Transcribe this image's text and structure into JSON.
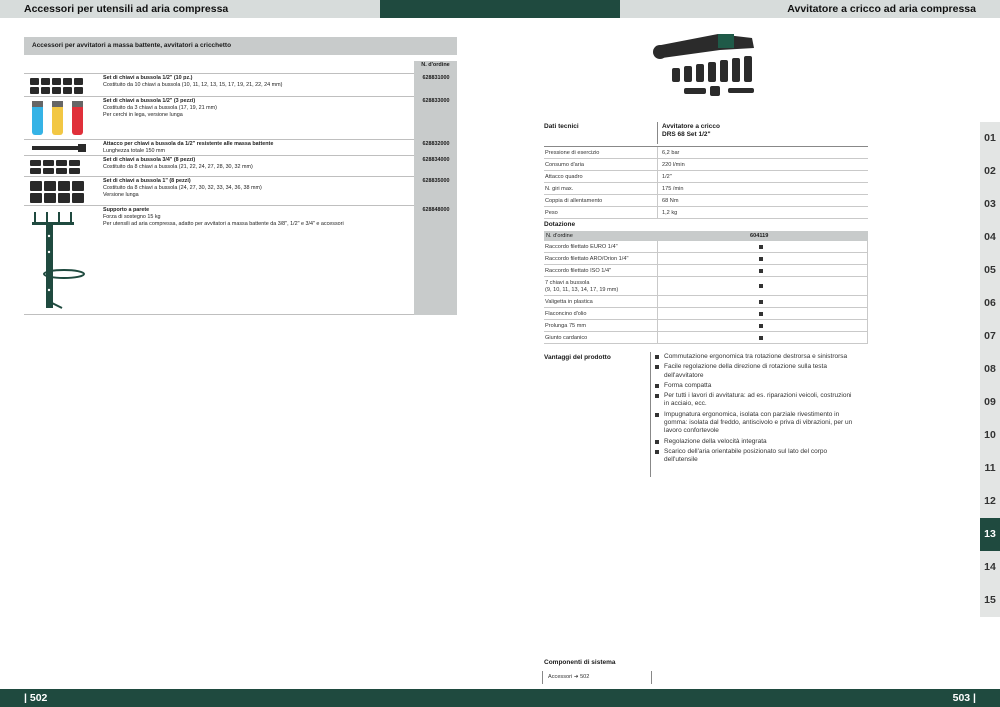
{
  "header": {
    "left_title": "Accessori per utensili ad aria compressa",
    "right_title": "Avvitatore a cricco ad aria compressa"
  },
  "footer": {
    "left_page": "| 502",
    "right_page": "503 |"
  },
  "accessories": {
    "section_title": "Accessori per avvitatori a massa battente, avvitatori a cricchetto",
    "order_header": "N. d'ordine",
    "items": [
      {
        "title": "Set di chiavi a bussola 1/2\" (10 pz.)",
        "lines": [
          "Costituito da 10 chiavi a bussola (10, 11, 12, 13, 15, 17, 19, 21, 22, 24 mm)"
        ],
        "order": "628831000"
      },
      {
        "title": "Set di chiavi a bussola 1/2\" (3 pezzi)",
        "lines": [
          "Costituito da 3 chiavi a bussola (17, 19, 21 mm)",
          "Per cerchi in lega, versione lunga"
        ],
        "order": "628833000"
      },
      {
        "title": "Attacco per chiavi a bussola da 1/2\" resistente alle massa battente",
        "lines": [
          "Lunghezza totale 150 mm"
        ],
        "order": "628832000"
      },
      {
        "title": "Set di chiavi a bussola 3/4\" (8 pezzi)",
        "lines": [
          "Costituito da 8 chiavi a bussola (21, 22, 24, 27, 28, 30, 32 mm)"
        ],
        "order": "628834000"
      },
      {
        "title": "Set di chiavi a bussola 1\" (8 pezzi)",
        "lines": [
          "Costituito da 8 chiavi a bussola (24, 27, 30, 32, 33, 34, 36, 38 mm)",
          "Versione lunga"
        ],
        "order": "628835000"
      },
      {
        "title": "Supporto a parete",
        "lines": [
          "Forza di sostegno 15 kg",
          "Per utensili ad aria compressa, adatto per avvitatori a massa battente da 3/8\", 1/2\" e 3/4\" e accessori"
        ],
        "order": "628848000"
      }
    ]
  },
  "tech": {
    "label": "Dati tecnici",
    "product_line1": "Avvitatore a cricco",
    "product_line2": "DRS 68 Set 1/2\"",
    "specs": [
      {
        "k": "Pressione di esercizio",
        "v": "6,2 bar"
      },
      {
        "k": "Consumo d'aria",
        "v": "220 l/min"
      },
      {
        "k": "Attacco quadro",
        "v": "1/2\""
      },
      {
        "k": "N. giri max.",
        "v": "175 /min"
      },
      {
        "k": "Coppia di allentamento",
        "v": "68 Nm"
      },
      {
        "k": "Peso",
        "v": "1,2 kg"
      }
    ]
  },
  "dotazione": {
    "label": "Dotazione",
    "order_label": "N. d'ordine",
    "order_value": "604119",
    "items": [
      "Raccordo filettato EURO 1/4\"",
      "Raccordo filettato ARO/Orion 1/4\"",
      "Raccordo filettato ISO 1/4\"",
      "7 chiavi a bussola",
      "Valigetta in plastica",
      "Flaconcino d'olio",
      "Prolunga 75 mm",
      "Giunto cardanico"
    ],
    "bussola_detail": "(9, 10, 11, 13, 14, 17, 19 mm)"
  },
  "advantages": {
    "label": "Vantaggi del prodotto",
    "items": [
      "Commutazione ergonomica tra rotazione destrorsa e sinistrorsa",
      "Facile regolazione della direzione di rotazione sulla testa dell'avvitatore",
      "Forma compatta",
      "Per tutti i lavori di avvitatura: ad es. riparazioni veicoli, costruzioni in acciaio, ecc.",
      "Impugnatura ergonomica, isolata con parziale rivestimento in gomma: isolata dal freddo, antiscivolo e priva di vibrazioni, per un lavoro confortevole",
      "Regolazione della velocità integrata",
      "Scarico dell'aria orientabile posizionato sul lato del corpo dell'utensile"
    ]
  },
  "system": {
    "label": "Componenti di sistema",
    "link_text": "Accessori",
    "arrow": "➜",
    "page_ref": "502"
  },
  "chapters": [
    "01",
    "02",
    "03",
    "04",
    "05",
    "06",
    "07",
    "08",
    "09",
    "10",
    "11",
    "12",
    "13",
    "14",
    "15"
  ],
  "active_chapter": "13",
  "colors": {
    "brand_green": "#1f4a3f",
    "grey_band": "#c8cbcb"
  }
}
